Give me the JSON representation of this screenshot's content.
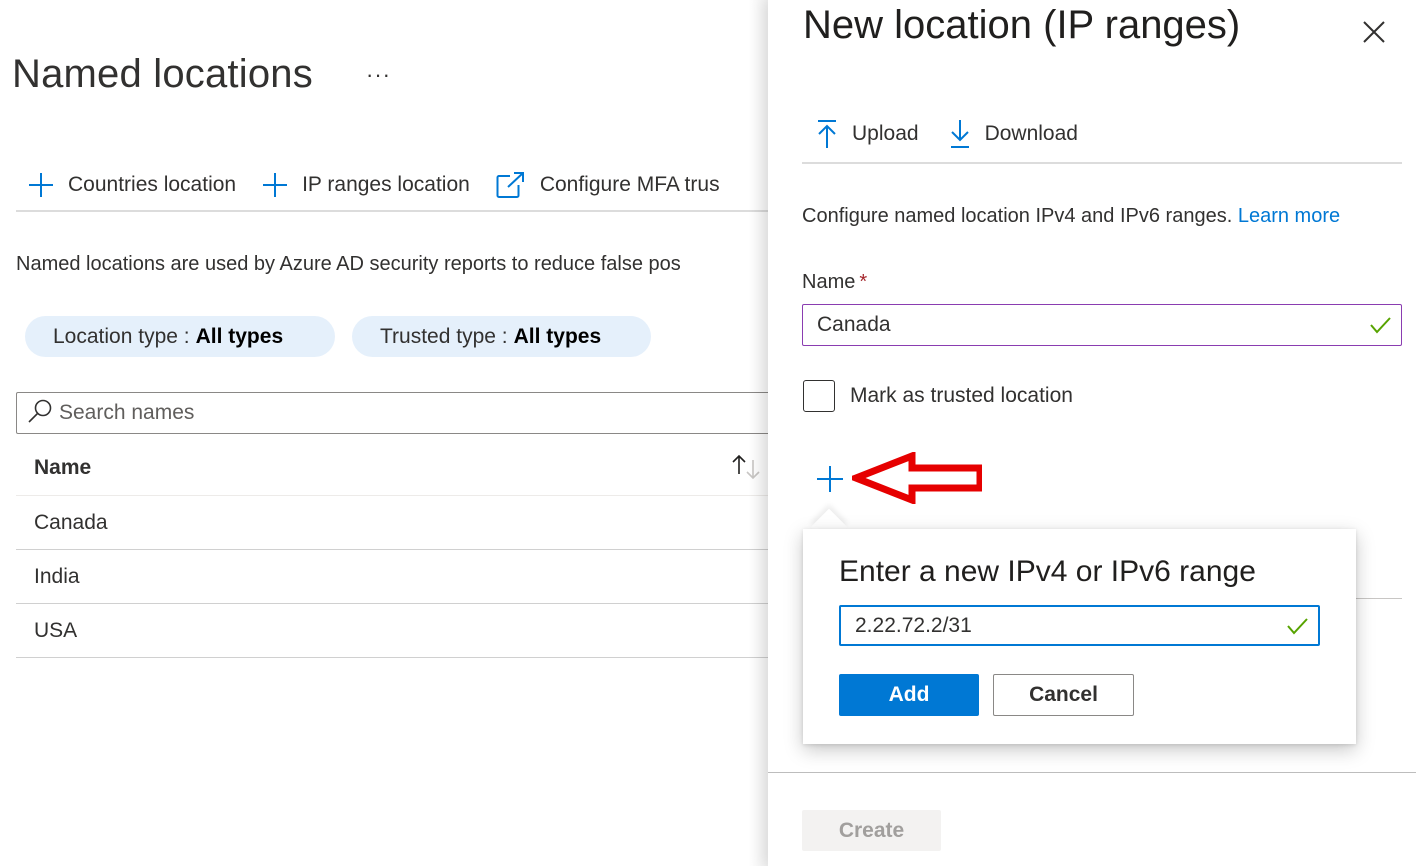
{
  "main": {
    "title": "Named locations",
    "more_label": "···",
    "commands": [
      {
        "label": "Countries location",
        "icon": "plus-icon"
      },
      {
        "label": "IP ranges location",
        "icon": "plus-icon"
      },
      {
        "label": "Configure MFA trus",
        "icon": "external-link-icon"
      }
    ],
    "description": "Named locations are used by Azure AD security reports to reduce false pos",
    "filters": [
      {
        "label": "Location type : ",
        "value": "All types"
      },
      {
        "label": "Trusted type : ",
        "value": "All types"
      }
    ],
    "search": {
      "placeholder": "Search names",
      "value": ""
    },
    "table": {
      "columns": [
        {
          "label": "Name",
          "sort": "ascending"
        }
      ],
      "rows": [
        {
          "name": "Canada"
        },
        {
          "name": "India"
        },
        {
          "name": "USA"
        }
      ]
    }
  },
  "panel": {
    "title": "New location (IP ranges)",
    "toolbar": [
      {
        "label": "Upload",
        "icon": "upload-icon"
      },
      {
        "label": "Download",
        "icon": "download-icon"
      }
    ],
    "description": "Configure named location IPv4 and IPv6 ranges. ",
    "learn_more": "Learn more",
    "name_field": {
      "label": "Name",
      "required_mark": "*",
      "value": "Canada",
      "valid": true
    },
    "trusted_checkbox": {
      "label": "Mark as trusted location",
      "checked": false
    },
    "create_label": "Create",
    "colors": {
      "accent": "#0078d4",
      "valid": "#57a300",
      "annotation": "#e60000",
      "focus_border_name": "#8a3db1"
    }
  },
  "callout": {
    "title": "Enter a new IPv4 or IPv6 range",
    "input_value": "2.22.72.2/31",
    "valid": true,
    "add_label": "Add",
    "cancel_label": "Cancel"
  }
}
